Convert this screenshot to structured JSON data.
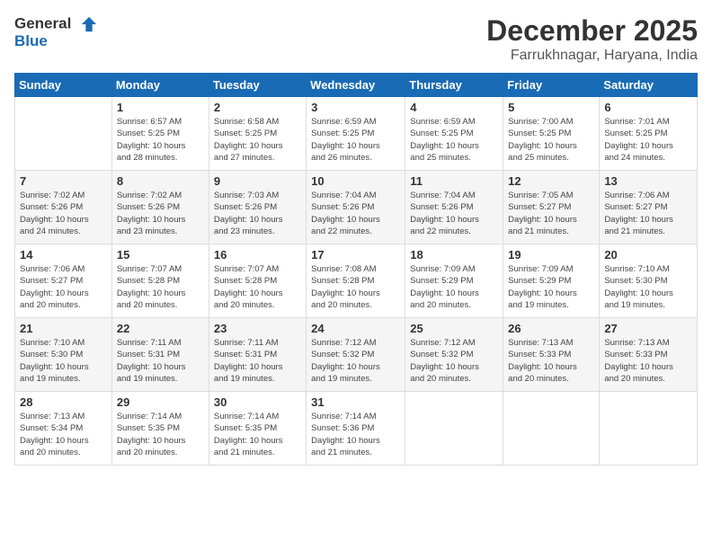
{
  "logo": {
    "line1": "General",
    "line2": "Blue"
  },
  "title": "December 2025",
  "subtitle": "Farrukhnagar, Haryana, India",
  "weekdays": [
    "Sunday",
    "Monday",
    "Tuesday",
    "Wednesday",
    "Thursday",
    "Friday",
    "Saturday"
  ],
  "weeks": [
    [
      {
        "day": "",
        "info": ""
      },
      {
        "day": "1",
        "info": "Sunrise: 6:57 AM\nSunset: 5:25 PM\nDaylight: 10 hours\nand 28 minutes."
      },
      {
        "day": "2",
        "info": "Sunrise: 6:58 AM\nSunset: 5:25 PM\nDaylight: 10 hours\nand 27 minutes."
      },
      {
        "day": "3",
        "info": "Sunrise: 6:59 AM\nSunset: 5:25 PM\nDaylight: 10 hours\nand 26 minutes."
      },
      {
        "day": "4",
        "info": "Sunrise: 6:59 AM\nSunset: 5:25 PM\nDaylight: 10 hours\nand 25 minutes."
      },
      {
        "day": "5",
        "info": "Sunrise: 7:00 AM\nSunset: 5:25 PM\nDaylight: 10 hours\nand 25 minutes."
      },
      {
        "day": "6",
        "info": "Sunrise: 7:01 AM\nSunset: 5:25 PM\nDaylight: 10 hours\nand 24 minutes."
      }
    ],
    [
      {
        "day": "7",
        "info": "Sunrise: 7:02 AM\nSunset: 5:26 PM\nDaylight: 10 hours\nand 24 minutes."
      },
      {
        "day": "8",
        "info": "Sunrise: 7:02 AM\nSunset: 5:26 PM\nDaylight: 10 hours\nand 23 minutes."
      },
      {
        "day": "9",
        "info": "Sunrise: 7:03 AM\nSunset: 5:26 PM\nDaylight: 10 hours\nand 23 minutes."
      },
      {
        "day": "10",
        "info": "Sunrise: 7:04 AM\nSunset: 5:26 PM\nDaylight: 10 hours\nand 22 minutes."
      },
      {
        "day": "11",
        "info": "Sunrise: 7:04 AM\nSunset: 5:26 PM\nDaylight: 10 hours\nand 22 minutes."
      },
      {
        "day": "12",
        "info": "Sunrise: 7:05 AM\nSunset: 5:27 PM\nDaylight: 10 hours\nand 21 minutes."
      },
      {
        "day": "13",
        "info": "Sunrise: 7:06 AM\nSunset: 5:27 PM\nDaylight: 10 hours\nand 21 minutes."
      }
    ],
    [
      {
        "day": "14",
        "info": "Sunrise: 7:06 AM\nSunset: 5:27 PM\nDaylight: 10 hours\nand 20 minutes."
      },
      {
        "day": "15",
        "info": "Sunrise: 7:07 AM\nSunset: 5:28 PM\nDaylight: 10 hours\nand 20 minutes."
      },
      {
        "day": "16",
        "info": "Sunrise: 7:07 AM\nSunset: 5:28 PM\nDaylight: 10 hours\nand 20 minutes."
      },
      {
        "day": "17",
        "info": "Sunrise: 7:08 AM\nSunset: 5:28 PM\nDaylight: 10 hours\nand 20 minutes."
      },
      {
        "day": "18",
        "info": "Sunrise: 7:09 AM\nSunset: 5:29 PM\nDaylight: 10 hours\nand 20 minutes."
      },
      {
        "day": "19",
        "info": "Sunrise: 7:09 AM\nSunset: 5:29 PM\nDaylight: 10 hours\nand 19 minutes."
      },
      {
        "day": "20",
        "info": "Sunrise: 7:10 AM\nSunset: 5:30 PM\nDaylight: 10 hours\nand 19 minutes."
      }
    ],
    [
      {
        "day": "21",
        "info": "Sunrise: 7:10 AM\nSunset: 5:30 PM\nDaylight: 10 hours\nand 19 minutes."
      },
      {
        "day": "22",
        "info": "Sunrise: 7:11 AM\nSunset: 5:31 PM\nDaylight: 10 hours\nand 19 minutes."
      },
      {
        "day": "23",
        "info": "Sunrise: 7:11 AM\nSunset: 5:31 PM\nDaylight: 10 hours\nand 19 minutes."
      },
      {
        "day": "24",
        "info": "Sunrise: 7:12 AM\nSunset: 5:32 PM\nDaylight: 10 hours\nand 19 minutes."
      },
      {
        "day": "25",
        "info": "Sunrise: 7:12 AM\nSunset: 5:32 PM\nDaylight: 10 hours\nand 20 minutes."
      },
      {
        "day": "26",
        "info": "Sunrise: 7:13 AM\nSunset: 5:33 PM\nDaylight: 10 hours\nand 20 minutes."
      },
      {
        "day": "27",
        "info": "Sunrise: 7:13 AM\nSunset: 5:33 PM\nDaylight: 10 hours\nand 20 minutes."
      }
    ],
    [
      {
        "day": "28",
        "info": "Sunrise: 7:13 AM\nSunset: 5:34 PM\nDaylight: 10 hours\nand 20 minutes."
      },
      {
        "day": "29",
        "info": "Sunrise: 7:14 AM\nSunset: 5:35 PM\nDaylight: 10 hours\nand 20 minutes."
      },
      {
        "day": "30",
        "info": "Sunrise: 7:14 AM\nSunset: 5:35 PM\nDaylight: 10 hours\nand 21 minutes."
      },
      {
        "day": "31",
        "info": "Sunrise: 7:14 AM\nSunset: 5:36 PM\nDaylight: 10 hours\nand 21 minutes."
      },
      {
        "day": "",
        "info": ""
      },
      {
        "day": "",
        "info": ""
      },
      {
        "day": "",
        "info": ""
      }
    ]
  ]
}
